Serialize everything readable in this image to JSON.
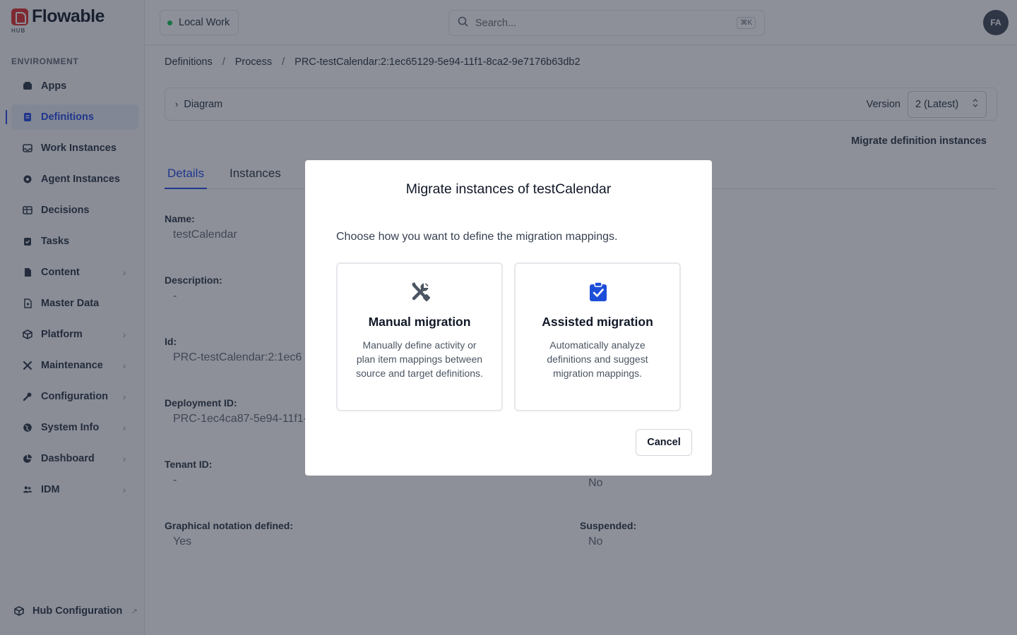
{
  "brand": {
    "name": "Flowable",
    "sub": "HUB"
  },
  "sidebar": {
    "section": "ENVIRONMENT",
    "items": [
      {
        "label": "Apps",
        "icon": "apps-icon",
        "chevron": false
      },
      {
        "label": "Definitions",
        "icon": "definitions-icon",
        "chevron": false,
        "active": true
      },
      {
        "label": "Work Instances",
        "icon": "inbox-icon",
        "chevron": false
      },
      {
        "label": "Agent Instances",
        "icon": "agent-icon",
        "chevron": false
      },
      {
        "label": "Decisions",
        "icon": "table-icon",
        "chevron": false
      },
      {
        "label": "Tasks",
        "icon": "clipboard-check-icon",
        "chevron": false
      },
      {
        "label": "Content",
        "icon": "document-icon",
        "chevron": true
      },
      {
        "label": "Master Data",
        "icon": "master-data-icon",
        "chevron": false
      },
      {
        "label": "Platform",
        "icon": "cube-icon",
        "chevron": true
      },
      {
        "label": "Maintenance",
        "icon": "tools-icon",
        "chevron": true
      },
      {
        "label": "Configuration",
        "icon": "wrench-icon",
        "chevron": true
      },
      {
        "label": "System Info",
        "icon": "globe-icon",
        "chevron": true
      },
      {
        "label": "Dashboard",
        "icon": "pie-chart-icon",
        "chevron": true
      },
      {
        "label": "IDM",
        "icon": "users-icon",
        "chevron": true
      }
    ],
    "footer": "Hub Configuration"
  },
  "topbar": {
    "workspace": "Local Work",
    "search_placeholder": "Search...",
    "search_shortcut": "⌘K",
    "avatar": "FA"
  },
  "breadcrumb": [
    "Definitions",
    "Process",
    "PRC-testCalendar:2:1ec65129-5e94-11f1-8ca2-9e7176b63db2"
  ],
  "diagram": {
    "label": "Diagram",
    "version_label": "Version",
    "version_value": "2 (Latest)"
  },
  "migrate_link": "Migrate definition instances",
  "tabs": [
    "Details",
    "Instances"
  ],
  "details": {
    "name_label": "Name:",
    "name_value": "testCalendar",
    "description_label": "Description:",
    "description_value": "-",
    "id_label": "Id:",
    "id_value": "PRC-testCalendar:2:1ec6",
    "deployment_label": "Deployment ID:",
    "deployment_value": "PRC-1ec4ca87-5e94-11f1-",
    "tenant_label": "Tenant ID:",
    "tenant_value": "-",
    "tenant_right_value": "No",
    "graphical_label": "Graphical notation defined:",
    "graphical_value": "Yes",
    "suspended_label": "Suspended:",
    "suspended_value": "No"
  },
  "modal": {
    "title": "Migrate instances of testCalendar",
    "prompt": "Choose how you want to define the migration mappings.",
    "manual": {
      "title": "Manual migration",
      "description": "Manually define activity or plan item mappings between source and target definitions."
    },
    "assisted": {
      "title": "Assisted migration",
      "description": "Automatically analyze definitions and suggest migration mappings."
    },
    "cancel": "Cancel"
  },
  "colors": {
    "accent": "#2f54eb",
    "brand": "#e23b3b",
    "assisted_icon": "#1d4ed8",
    "manual_icon": "#4b5563"
  }
}
